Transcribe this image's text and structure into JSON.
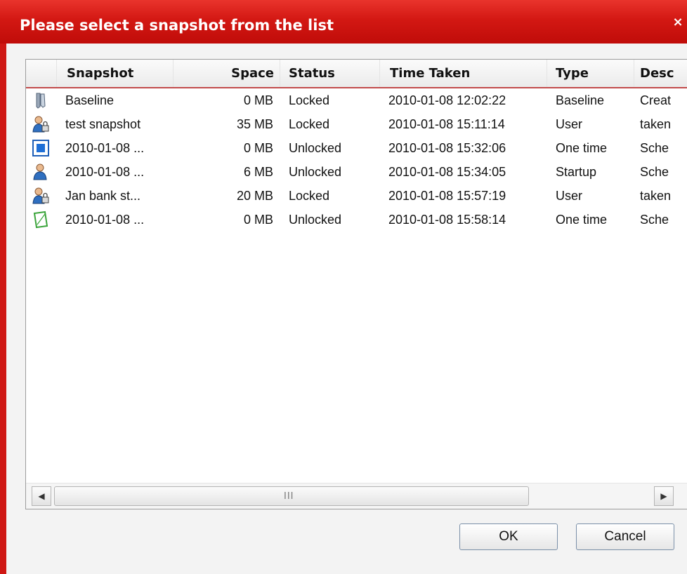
{
  "window": {
    "title": "Please select a snapshot from the list",
    "close_glyph": "×"
  },
  "columns": [
    "Snapshot",
    "Space",
    "Status",
    "Time Taken",
    "Type",
    "Desc"
  ],
  "rows": [
    {
      "icon": "baseline-icon",
      "snapshot": "Baseline",
      "space": "0 MB",
      "status": "Locked",
      "time": "2010-01-08 12:02:22",
      "type": "Baseline",
      "desc": "Creat"
    },
    {
      "icon": "user-locked-icon",
      "snapshot": "test snapshot",
      "space": "35 MB",
      "status": "Locked",
      "time": "2010-01-08 15:11:14",
      "type": "User",
      "desc": "taken"
    },
    {
      "icon": "one-time-icon",
      "snapshot": "2010-01-08 ...",
      "space": "0 MB",
      "status": "Unlocked",
      "time": "2010-01-08 15:32:06",
      "type": "One time",
      "desc": "Sche"
    },
    {
      "icon": "startup-user-icon",
      "snapshot": "2010-01-08 ...",
      "space": "6 MB",
      "status": "Unlocked",
      "time": "2010-01-08 15:34:05",
      "type": "Startup",
      "desc": "Sche"
    },
    {
      "icon": "user-locked-icon",
      "snapshot": "Jan bank st...",
      "space": "20 MB",
      "status": "Locked",
      "time": "2010-01-08 15:57:19",
      "type": "User",
      "desc": "taken"
    },
    {
      "icon": "green-page-icon",
      "snapshot": "2010-01-08 ...",
      "space": "0 MB",
      "status": "Unlocked",
      "time": "2010-01-08 15:58:14",
      "type": "One time",
      "desc": "Sche"
    }
  ],
  "scrollbar": {
    "left_arrow": "◀",
    "right_arrow": "▶",
    "grip": "III"
  },
  "buttons": {
    "ok": "OK",
    "cancel": "Cancel"
  },
  "colors": {
    "titlebar": "#d31813",
    "header_underline": "#c24b4b"
  }
}
